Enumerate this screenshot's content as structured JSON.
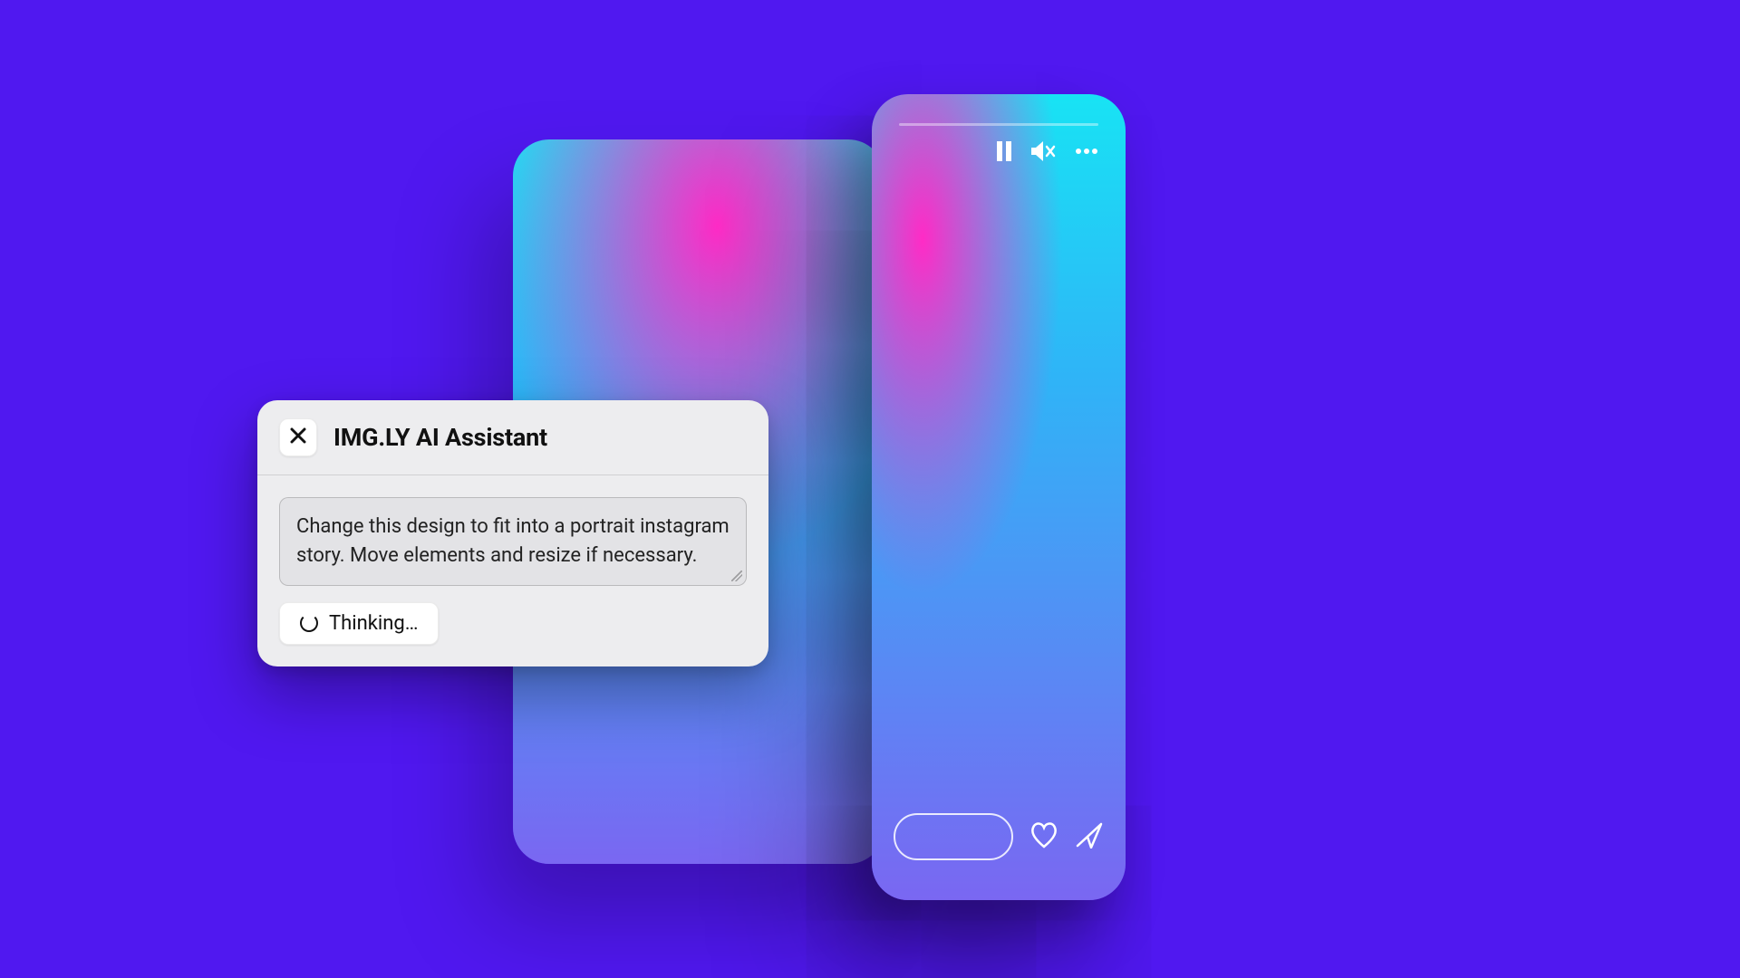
{
  "assistant": {
    "title": "IMG.LY AI Assistant",
    "prompt": "Change this design to fit into a portrait instagram story. Move elements and resize if necessary.",
    "status": "Thinking…"
  },
  "icons": {
    "close": "close-icon",
    "pause": "pause-icon",
    "mute": "volume-mute-icon",
    "more": "more-icon",
    "heart": "heart-icon",
    "send": "send-icon",
    "spinner": "spinner-icon"
  }
}
